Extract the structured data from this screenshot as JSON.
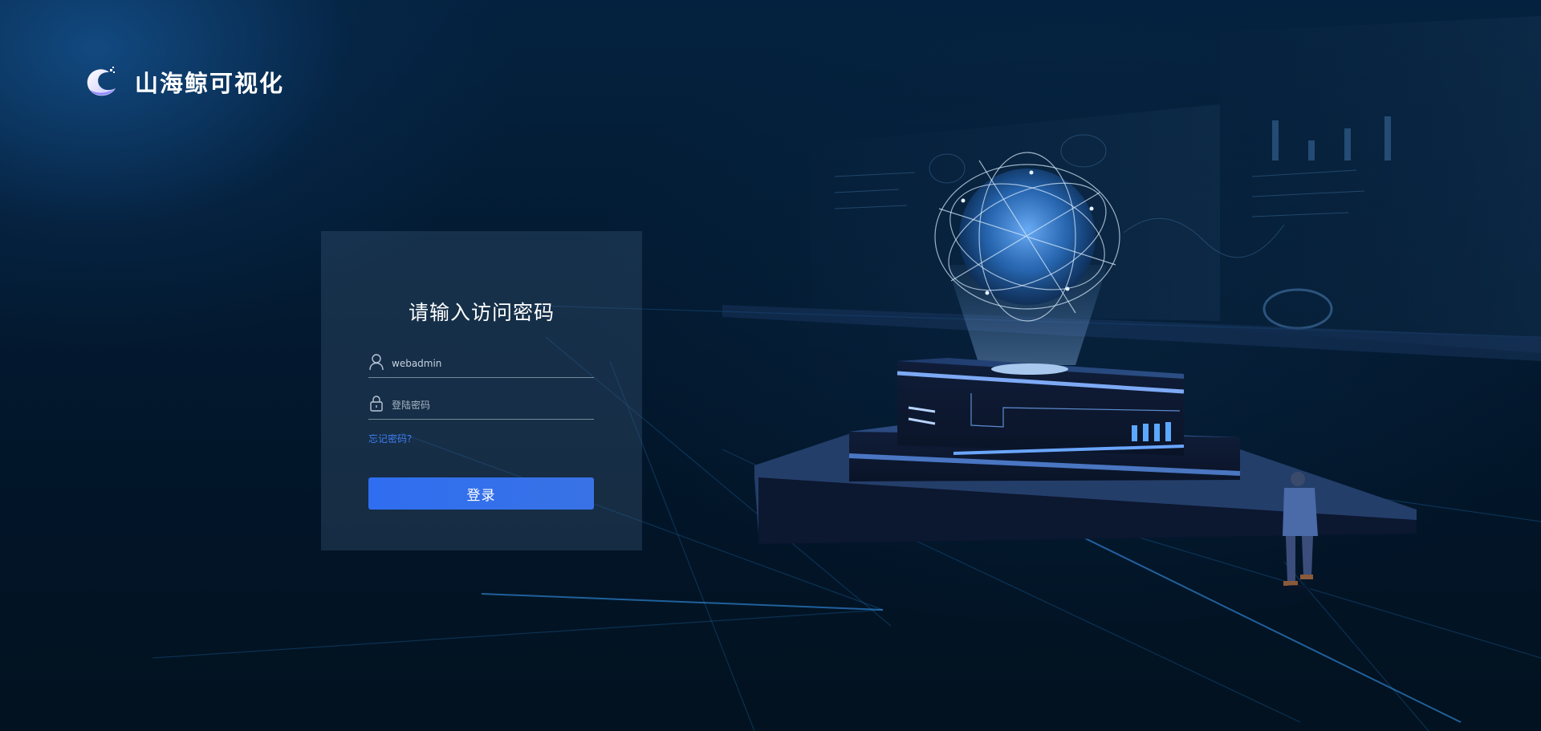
{
  "brand": {
    "name": "山海鲸可视化"
  },
  "login": {
    "title": "请输入访问密码",
    "username_value": "webadmin",
    "password_placeholder": "登陆密码",
    "forgot_label": "忘记密码?",
    "submit_label": "登录"
  },
  "icons": {
    "logo": "whale-logo-icon",
    "user": "user-icon",
    "lock": "lock-icon"
  },
  "colors": {
    "accent": "#2f6ef0",
    "link": "#3f7df0",
    "background": "#031a31"
  }
}
